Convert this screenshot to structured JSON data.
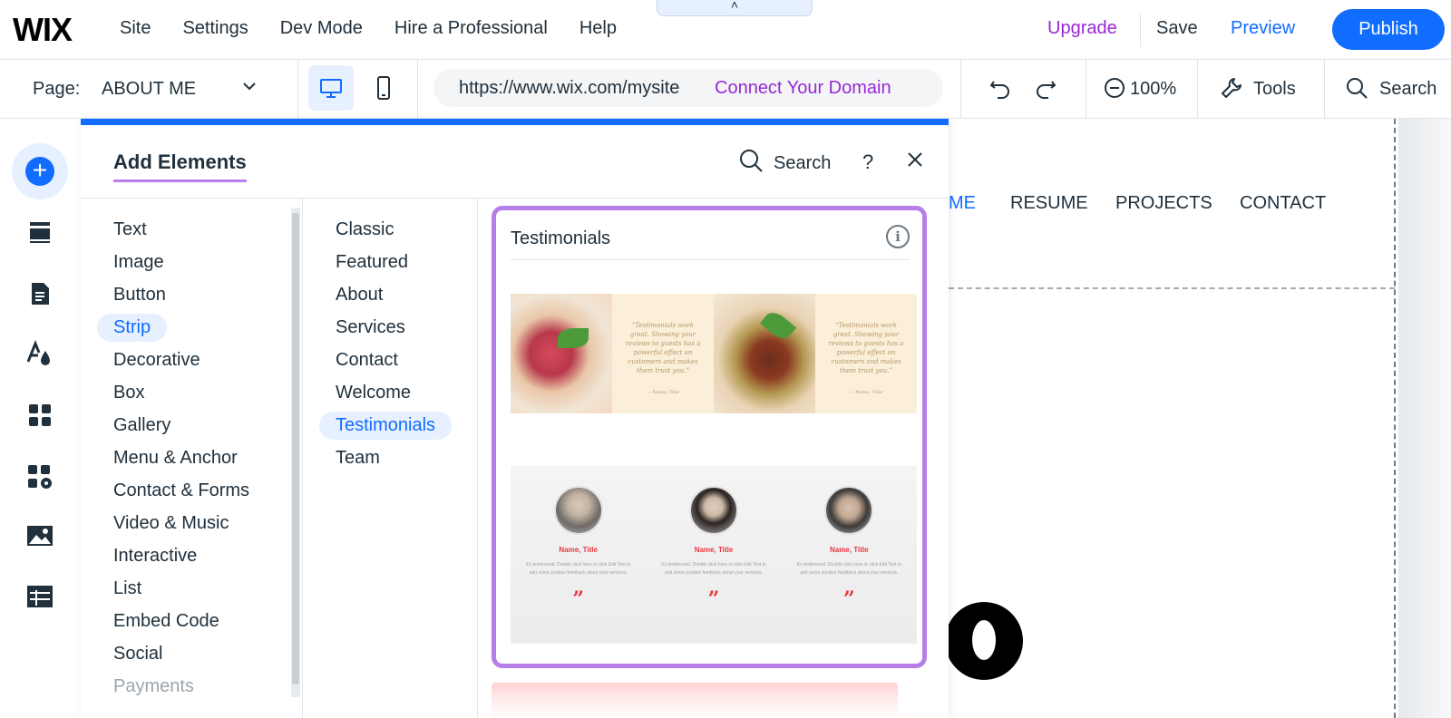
{
  "topbar": {
    "logo": "WIX",
    "menu": [
      "Site",
      "Settings",
      "Dev Mode",
      "Hire a Professional",
      "Help"
    ],
    "handle": "˄",
    "upgrade": "Upgrade",
    "save": "Save",
    "preview": "Preview",
    "publish": "Publish"
  },
  "toolbar": {
    "page_label": "Page:",
    "page_name": "ABOUT ME",
    "url": "https://www.wix.com/mysite",
    "connect_domain": "Connect Your Domain",
    "zoom": "100%",
    "tools": "Tools",
    "search": "Search"
  },
  "rail": {
    "icons": [
      "add-icon",
      "sections-icon",
      "pages-icon",
      "design-icon",
      "apps-icon",
      "business-icon",
      "media-icon",
      "cms-icon"
    ]
  },
  "panel": {
    "title": "Add Elements",
    "search": "Search",
    "help": "?",
    "categories": [
      "Text",
      "Image",
      "Button",
      "Strip",
      "Decorative",
      "Box",
      "Gallery",
      "Menu & Anchor",
      "Contact & Forms",
      "Video & Music",
      "Interactive",
      "List",
      "Embed Code",
      "Social",
      "Payments"
    ],
    "selected_category": "Strip",
    "subcategories": [
      "Classic",
      "Featured",
      "About",
      "Services",
      "Contact",
      "Welcome",
      "Testimonials",
      "Team"
    ],
    "selected_subcategory": "Testimonials",
    "card": {
      "title": "Testimonials",
      "info": "i",
      "quote1": "“Testimonials work great. Showing your reviews to guests has a powerful effect on customers and makes them trust you.”",
      "quote1_sig": "— Name, Title",
      "quote2": "“Testimonials work great. Showing your reviews to guests has a powerful effect on customers and makes them trust you.”",
      "quote2_sig": "— Name, Title",
      "people": [
        {
          "name": "Name, Title",
          "text": "It's testimonial. Double click here or click Edit Text to add some positive feedback about your services."
        },
        {
          "name": "Name, Title",
          "text": "It's testimonial. Double click here or click Edit Text to add some positive feedback about your services."
        },
        {
          "name": "Name, Title",
          "text": "It's testimonial. Double click here or click Edit Text to add some positive feedback about your services."
        }
      ],
      "quote_mark": "”"
    }
  },
  "site": {
    "nav": [
      "ME",
      "RESUME",
      "PROJECTS",
      "CONTACT"
    ]
  },
  "colors": {
    "accent": "#116dff",
    "purple": "#9a27d5",
    "highlight": "#b77ee9"
  }
}
